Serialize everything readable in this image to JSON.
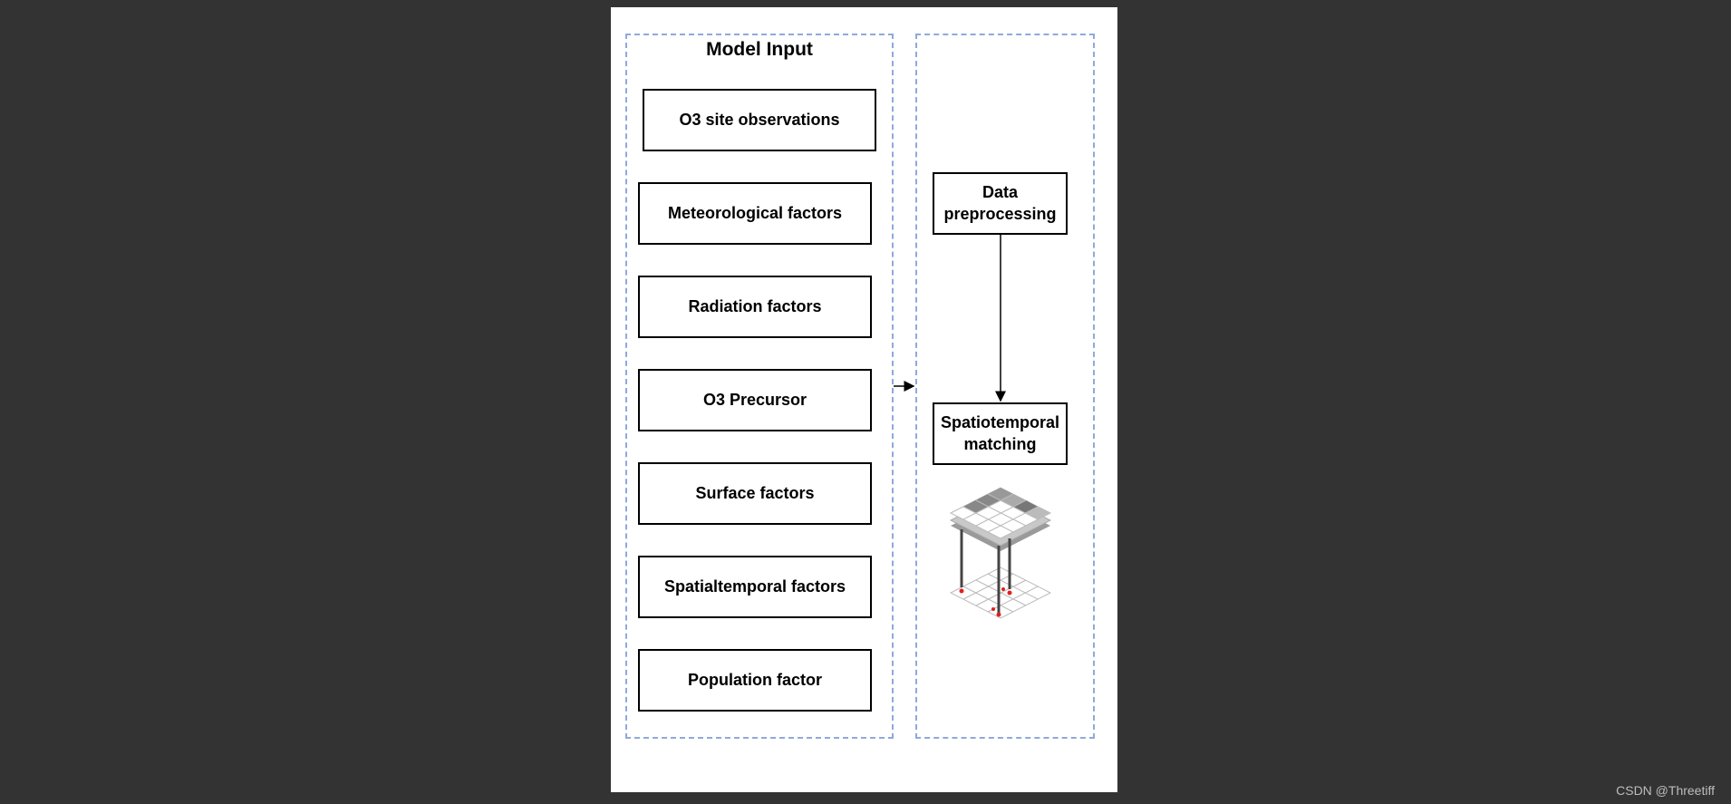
{
  "diagram": {
    "left_panel": {
      "title": "Model Input",
      "items": [
        {
          "label": "O3 site observations"
        },
        {
          "label": "Meteorological factors"
        },
        {
          "label": "Radiation factors"
        },
        {
          "label": "O3 Precursor"
        },
        {
          "label": "Surface factors"
        },
        {
          "label": "Spatialtemporal factors"
        },
        {
          "label": "Population  factor"
        }
      ]
    },
    "right_panel": {
      "steps": [
        {
          "label": "Data preprocessing"
        },
        {
          "label": "Spatiotemporal matching"
        }
      ],
      "illustration": "grid-layers-icon"
    },
    "colors": {
      "dashed_border": "#8eaadb",
      "box_border": "#000000",
      "marker": "#e02020"
    }
  },
  "watermark": "CSDN @Threetiff"
}
